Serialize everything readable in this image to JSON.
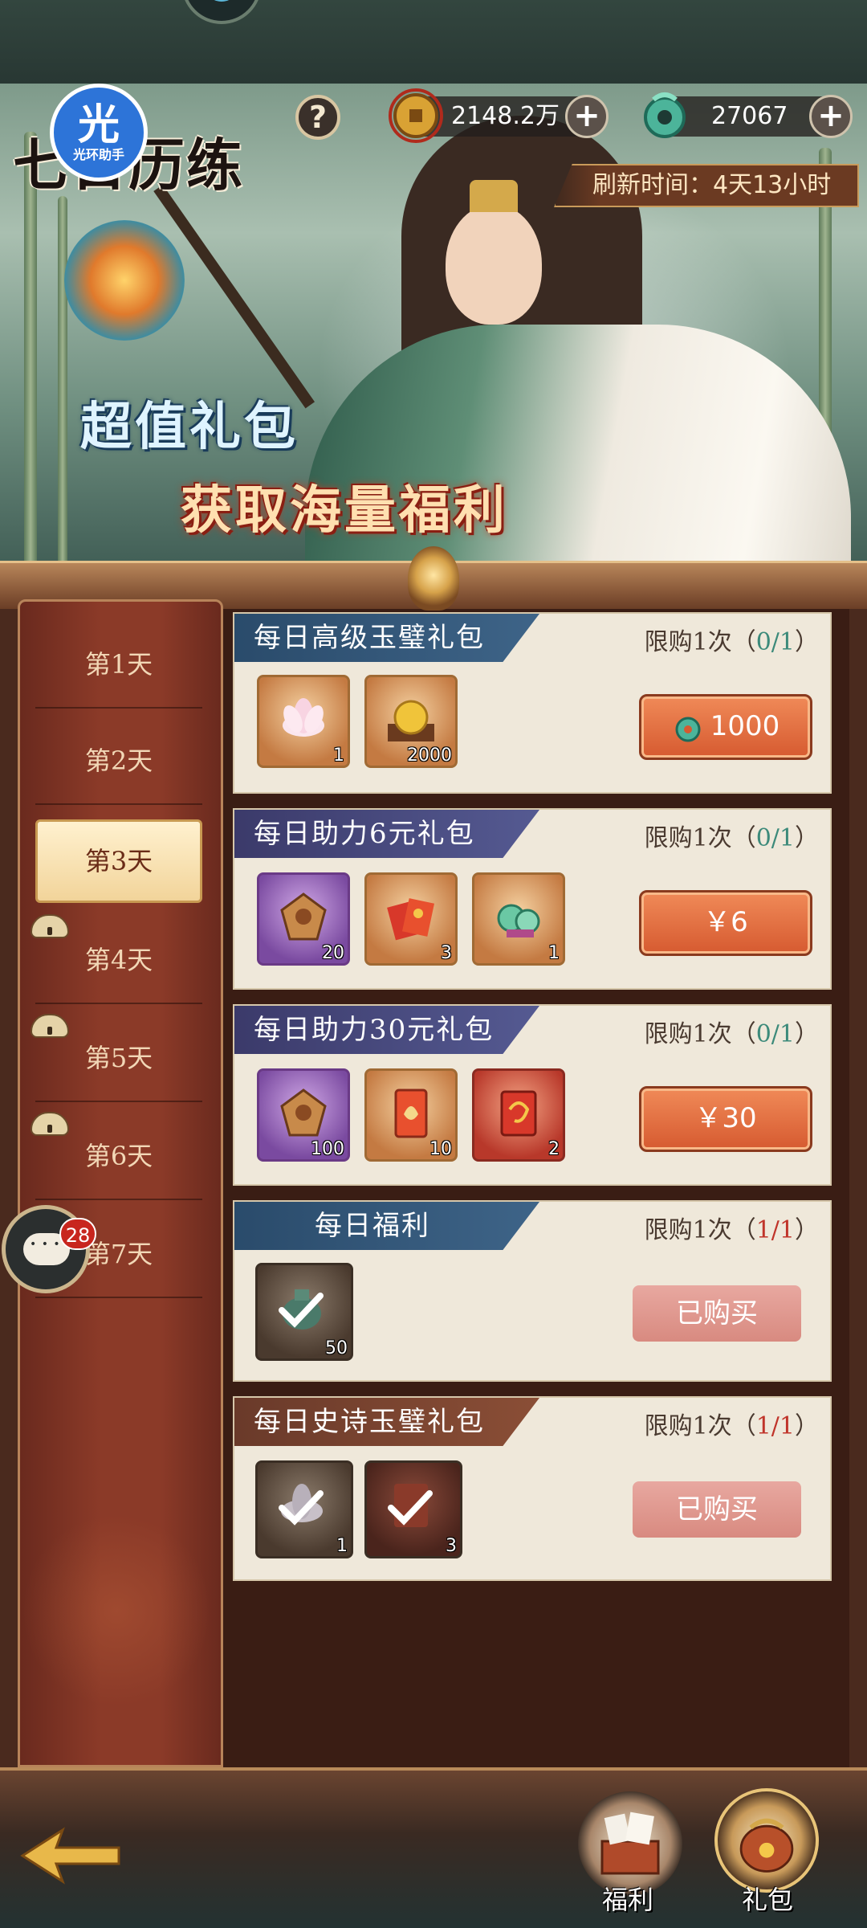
{
  "header": {
    "title": "七日历练",
    "logo_big": "光",
    "logo_small": "光环助手",
    "help_label": "?",
    "coins": "2148.2万",
    "jade": "27067",
    "plus": "+",
    "refresh_label": "刷新时间：",
    "refresh_value": "4天13小时"
  },
  "banner": {
    "line1": "超值礼包",
    "line2": "获取海量福利"
  },
  "days": [
    {
      "label": "第1天",
      "state": "normal"
    },
    {
      "label": "第2天",
      "state": "normal"
    },
    {
      "label": "第3天",
      "state": "active"
    },
    {
      "label": "第4天",
      "state": "locked"
    },
    {
      "label": "第5天",
      "state": "locked"
    },
    {
      "label": "第6天",
      "state": "locked"
    },
    {
      "label": "第7天",
      "state": "locked"
    }
  ],
  "chat_badge": "28",
  "limit_prefix": "限购1次（",
  "limit_suffix": "）",
  "packs": [
    {
      "title": "每日高级玉璧礼包",
      "limit_count": "0/1",
      "items": [
        {
          "icon": "lotus-icon",
          "qty": "1"
        },
        {
          "icon": "gold-orb-icon",
          "qty": "2000"
        }
      ],
      "price": "1000",
      "price_type": "jade"
    },
    {
      "title": "每日助力6元礼包",
      "limit_count": "0/1",
      "items": [
        {
          "icon": "token-icon",
          "qty": "20"
        },
        {
          "icon": "red-envelope-icon",
          "qty": "3"
        },
        {
          "icon": "jade-bundle-icon",
          "qty": "1"
        }
      ],
      "price": "￥6"
    },
    {
      "title": "每日助力30元礼包",
      "limit_count": "0/1",
      "items": [
        {
          "icon": "token-icon",
          "qty": "100"
        },
        {
          "icon": "scroll-icon",
          "qty": "10"
        },
        {
          "icon": "dragon-envelope-icon",
          "qty": "2"
        }
      ],
      "price": "￥30"
    },
    {
      "title": "每日福利",
      "limit_count": "1/1",
      "items": [
        {
          "icon": "jade-check-icon",
          "qty": "50"
        }
      ],
      "status": "已购买"
    },
    {
      "title": "每日史诗玉璧礼包",
      "limit_count": "1/1",
      "items": [
        {
          "icon": "lotus-check-icon",
          "qty": "1"
        },
        {
          "icon": "envelope-check-icon",
          "qty": "3"
        }
      ],
      "status": "已购买"
    }
  ],
  "bottom": {
    "welfare_label": "福利",
    "gift_label": "礼包"
  }
}
